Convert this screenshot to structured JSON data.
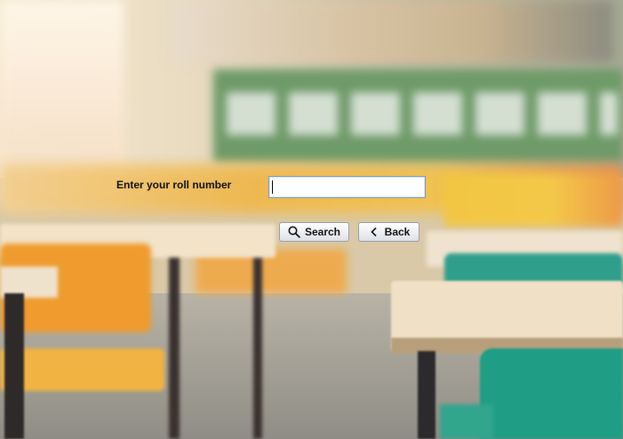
{
  "form": {
    "label": "Enter your roll number",
    "roll_value": "",
    "search_label": "Search",
    "back_label": "Back"
  },
  "icons": {
    "search": "search-icon",
    "back": "chevron-left-icon"
  }
}
